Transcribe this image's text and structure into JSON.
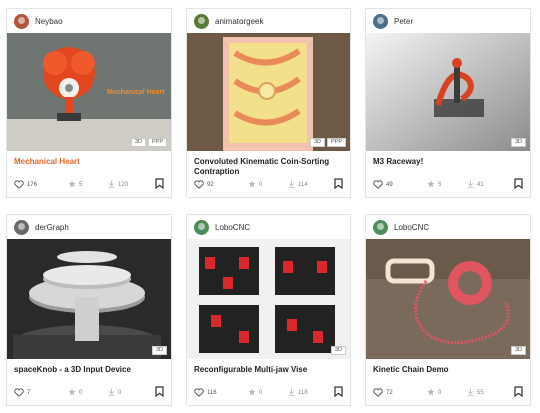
{
  "cards": [
    {
      "user": "Neybao",
      "avatar_color": "#b0563a",
      "title": "Mechanical Heart",
      "title_accent": true,
      "image_caption": "Mechanical Heart",
      "tags": [
        "3D",
        "PPP"
      ],
      "likes": "176",
      "rating": "5",
      "downloads": "120"
    },
    {
      "user": "animatorgeek",
      "avatar_color": "#5a7a3a",
      "title": "Convoluted Kinematic Coin-Sorting Contraption",
      "title_accent": false,
      "tags": [
        "3D",
        "PPP"
      ],
      "likes": "92",
      "rating": "0",
      "downloads": "114"
    },
    {
      "user": "Peter",
      "avatar_color": "#4d6e8a",
      "title": "M3 Raceway!",
      "title_accent": false,
      "tags": [
        "3D"
      ],
      "likes": "49",
      "rating": "5",
      "downloads": "41"
    },
    {
      "user": "derGraph",
      "avatar_color": "#6a6a6a",
      "title": "spaceKnob - a 3D Input Device",
      "title_accent": false,
      "tags": [
        "3D"
      ],
      "likes": "7",
      "rating": "0",
      "downloads": "0"
    },
    {
      "user": "LoboCNC",
      "avatar_color": "#4f8c5a",
      "title": "Reconfigurable Multi-jaw Vise",
      "title_accent": false,
      "tags": [
        "3D"
      ],
      "likes": "116",
      "rating": "0",
      "downloads": "118"
    },
    {
      "user": "LoboCNC",
      "avatar_color": "#4f8c5a",
      "title": "Kinetic Chain Demo",
      "title_accent": false,
      "tags": [
        "3D"
      ],
      "likes": "72",
      "rating": "0",
      "downloads": "55"
    }
  ]
}
